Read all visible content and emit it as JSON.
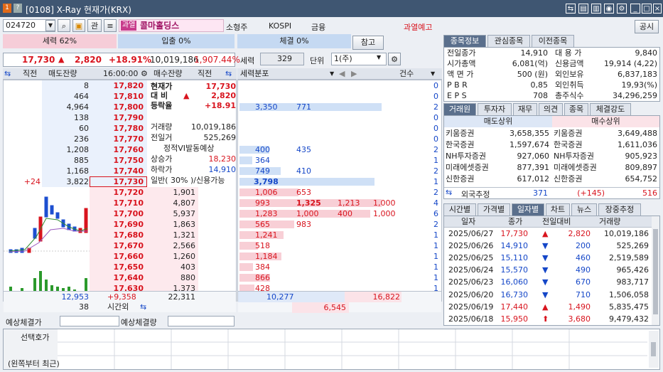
{
  "window": {
    "title": "[0108] X-Ray 현재가(KRX)",
    "close": "×",
    "min": "_",
    "restore": "□"
  },
  "toolbar": {
    "code": "024720",
    "kwan": "관",
    "badge": "과열",
    "name": "콜마홀딩스",
    "tag1": "소형주",
    "market": "KOSPI",
    "sector": "금융",
    "status": "과열예고",
    "notice": "공시"
  },
  "summary": {
    "power": "세력 62%",
    "inflow": "입출 0%",
    "trade": "체결 0%",
    "ref": "참고",
    "price": "17,730",
    "change": "2,820",
    "rate": "+18.91%",
    "volume": "10,019,186",
    "vol_rate": "1,907.44%",
    "power_label": "세력",
    "power_val": "329",
    "unit_label": "단위",
    "unit_val": "1(주)"
  },
  "ob_header": {
    "prev": "직전",
    "sell": "매도잔량",
    "time": "16:00:00",
    "buy": "매수잔량",
    "prev2": "직전",
    "flow": "세력분포",
    "count": "건수"
  },
  "asks": [
    {
      "qty": "8",
      "price": "17,820",
      "cnt": "0"
    },
    {
      "qty": "464",
      "price": "17,810",
      "cnt": "0"
    },
    {
      "qty": "4,964",
      "price": "17,800",
      "cnt": "2",
      "f1": "3,350",
      "f2": "771"
    },
    {
      "qty": "138",
      "price": "17,790",
      "cnt": "0"
    },
    {
      "qty": "60",
      "price": "17,780",
      "cnt": "0"
    },
    {
      "qty": "236",
      "price": "17,770",
      "cnt": "0"
    },
    {
      "qty": "1,208",
      "price": "17,760",
      "cnt": "2",
      "f1": "400",
      "f2": "435"
    },
    {
      "qty": "885",
      "price": "17,750",
      "cnt": "1",
      "f1": "364"
    },
    {
      "qty": "1,168",
      "price": "17,740",
      "cnt": "2",
      "f1": "749",
      "f2": "410"
    },
    {
      "qty": "3,822",
      "price": "17,730",
      "cnt": "1",
      "f1": "3,798",
      "prev": "+24"
    }
  ],
  "bids": [
    {
      "qty": "1,901",
      "price": "17,720",
      "cnt": "2",
      "f1": "1,006",
      "f2": "653"
    },
    {
      "qty": "4,807",
      "price": "17,710",
      "cnt": "4",
      "f1": "993",
      "f2": "1,325",
      "f3": "1,213",
      "f4": "1,000"
    },
    {
      "qty": "5,937",
      "price": "17,700",
      "cnt": "6",
      "f1": "1,283",
      "f2": "1,000",
      "f3": "400",
      "f4": "1,000"
    },
    {
      "qty": "1,863",
      "price": "17,690",
      "cnt": "2",
      "f1": "565",
      "f2": "983"
    },
    {
      "qty": "1,321",
      "price": "17,680",
      "cnt": "1",
      "f1": "1,241"
    },
    {
      "qty": "2,566",
      "price": "17,670",
      "cnt": "1",
      "f1": "518"
    },
    {
      "qty": "1,260",
      "price": "17,660",
      "cnt": "1",
      "f1": "1,184"
    },
    {
      "qty": "403",
      "price": "17,650",
      "cnt": "1",
      "f1": "384"
    },
    {
      "qty": "880",
      "price": "17,640",
      "cnt": "1",
      "f1": "866"
    },
    {
      "qty": "1,373",
      "price": "17,630",
      "cnt": "1",
      "f1": "428"
    }
  ],
  "info": [
    {
      "k": "현재가",
      "v": "17,730"
    },
    {
      "k": "대 비",
      "v": "2,820"
    },
    {
      "k": "등락율",
      "v": "+18.91"
    },
    {
      "k": "거래량",
      "v": "10,019,186"
    },
    {
      "k": "전일거",
      "v": "525,269"
    },
    {
      "k": "정적VI발동예상",
      "v": ""
    },
    {
      "k": "상승가",
      "v": "18,230"
    },
    {
      "k": "하락가",
      "v": "14,910"
    },
    {
      "k": "일반( 30% )/신용가능",
      "v": ""
    }
  ],
  "totals": {
    "ask": "12,953",
    "bid": "22,311",
    "diff": "+9,358",
    "after": "38",
    "after_label": "시간외",
    "f_ask": "10,277",
    "f_bid": "16,822",
    "f_diff": "6,545",
    "exp_price": "예상체결가",
    "exp_vol": "예상체결량",
    "sel_label": "선택호가",
    "recent": "(왼쪽부터 최근)"
  },
  "tabs1": [
    "종목정보",
    "관심종목",
    "이전종목"
  ],
  "stock": [
    {
      "k": "전일종가",
      "v": "14,910",
      "k2": "대 용 가",
      "v2": "9,840"
    },
    {
      "k": "시가총액",
      "v": "6,081(억)",
      "k2": "신용금액",
      "v2": "19,914  (4,22)"
    },
    {
      "k": "액 면 가",
      "v": "500 (원)",
      "k2": "외인보유",
      "v2": "6,837,183"
    },
    {
      "k": "P B R",
      "v": "0,85",
      "k2": "외인취득",
      "v2": "19,93(%)"
    },
    {
      "k": "E P S",
      "v": "708",
      "k2": "총주식수",
      "v2": "34,296,259"
    }
  ],
  "tabs2": [
    "거래원",
    "투자자",
    "재무",
    "의견",
    "종목",
    "체결강도"
  ],
  "broker": {
    "sell_h": "매도상위",
    "buy_h": "매수상위",
    "foreign": "외국추정",
    "f_sell": "371",
    "f_diff": "(+145)",
    "f_buy": "516",
    "rows": [
      {
        "s": "키움증권",
        "sv": "3,658,355",
        "b": "키움증권",
        "bv": "3,649,488"
      },
      {
        "s": "한국증권",
        "sv": "1,597,674",
        "b": "한국증권",
        "bv": "1,611,036"
      },
      {
        "s": "NH투자증권",
        "sv": "927,060",
        "b": "NH투자증권",
        "bv": "905,923"
      },
      {
        "s": "미래에셋증권",
        "sv": "877,391",
        "b": "미래에셋증권",
        "bv": "809,897"
      },
      {
        "s": "신한증권",
        "sv": "617,012",
        "b": "신한증권",
        "bv": "654,752"
      }
    ]
  },
  "tabs3": [
    "시간별",
    "가격별",
    "일자별",
    "차트",
    "뉴스",
    "장중추정"
  ],
  "daily": {
    "h": [
      "일자",
      "종가",
      "전일대비",
      "거래량"
    ],
    "rows": [
      {
        "d": "2025/06/27",
        "c": "17,730",
        "ch": "2,820",
        "v": "10,019,186",
        "up": true
      },
      {
        "d": "2025/06/26",
        "c": "14,910",
        "ch": "200",
        "v": "525,269",
        "up": false
      },
      {
        "d": "2025/06/25",
        "c": "15,110",
        "ch": "460",
        "v": "2,519,589",
        "up": false
      },
      {
        "d": "2025/06/24",
        "c": "15,570",
        "ch": "490",
        "v": "965,426",
        "up": false
      },
      {
        "d": "2025/06/23",
        "c": "16,060",
        "ch": "670",
        "v": "983,717",
        "up": false
      },
      {
        "d": "2025/06/20",
        "c": "16,730",
        "ch": "710",
        "v": "1,506,058",
        "up": false
      },
      {
        "d": "2025/06/19",
        "c": "17,440",
        "ch": "1,490",
        "v": "5,835,475",
        "up": true
      },
      {
        "d": "2025/06/18",
        "c": "15,950",
        "ch": "3,680",
        "v": "9,479,432",
        "up": true,
        "limit": true
      }
    ]
  }
}
